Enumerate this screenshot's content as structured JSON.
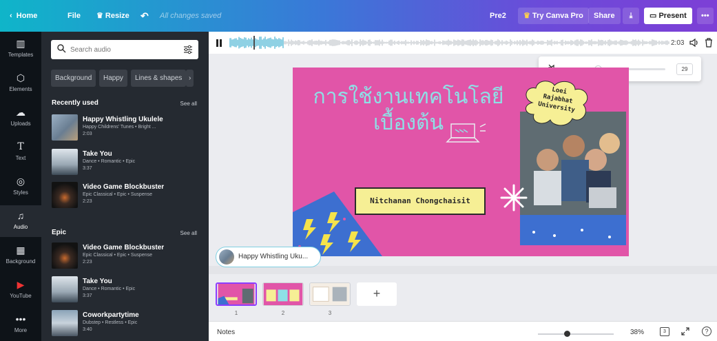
{
  "topbar": {
    "home": "Home",
    "file": "File",
    "resize": "Resize",
    "saved": "All changes saved",
    "doc_name": "Pre2",
    "try_pro": "Try Canva Pro",
    "share": "Share",
    "present": "Present",
    "more": "•••"
  },
  "rail": {
    "items": [
      {
        "label": "Templates",
        "icon": "templates-icon"
      },
      {
        "label": "Elements",
        "icon": "elements-icon"
      },
      {
        "label": "Uploads",
        "icon": "uploads-icon"
      },
      {
        "label": "Text",
        "icon": "text-icon"
      },
      {
        "label": "Styles",
        "icon": "styles-icon"
      },
      {
        "label": "Audio",
        "icon": "audio-icon"
      },
      {
        "label": "Background",
        "icon": "background-icon"
      },
      {
        "label": "YouTube",
        "icon": "youtube-icon"
      },
      {
        "label": "More",
        "icon": "more-icon"
      }
    ]
  },
  "panel": {
    "search_placeholder": "Search audio",
    "chips": [
      "Background",
      "Happy",
      "Lines & shapes"
    ],
    "recent": {
      "title": "Recently used",
      "see_all": "See all",
      "tracks": [
        {
          "title": "Happy Whistling Ukulele",
          "sub": "Happy Childrens' Tunes • Bright ...",
          "dur": "2:03"
        },
        {
          "title": "Take You",
          "sub": "Dance • Romantic • Epic",
          "dur": "3:37"
        },
        {
          "title": "Video Game Blockbuster",
          "sub": "Epic Classical • Epic • Suspense",
          "dur": "2:23"
        }
      ]
    },
    "epic": {
      "title": "Epic",
      "see_all": "See all",
      "tracks": [
        {
          "title": "Video Game Blockbuster",
          "sub": "Epic Classical • Epic • Suspense",
          "dur": "2:23"
        },
        {
          "title": "Take You",
          "sub": "Dance • Romantic • Epic",
          "dur": "3:37"
        },
        {
          "title": "Coworkpartytime",
          "sub": "Dubstep • Restless • Epic",
          "dur": "3:40"
        }
      ]
    }
  },
  "audio": {
    "time": "2:03",
    "volume": 29,
    "volume_fraction": 0.29
  },
  "slide": {
    "title_line1": "การใช้งานเทคโนโลยี",
    "title_line2": "เบื้องต้น",
    "name": "Nitchanan Chongchaisit",
    "seal_line1": "Loei",
    "seal_line2": "Rajabhat",
    "seal_line3": "University"
  },
  "canvas_audio_chip": "Happy Whistling Uku...",
  "pages": [
    "1",
    "2",
    "3"
  ],
  "add_page": "+",
  "footer": {
    "notes": "Notes",
    "zoom": "38%",
    "zoom_fraction": 0.38,
    "page_count": "3",
    "help": "?"
  },
  "colors": {
    "accent": "#8b3dff",
    "slide_bg": "#e155a8",
    "title": "#8ee0e6",
    "banner": "#f6ef95"
  }
}
